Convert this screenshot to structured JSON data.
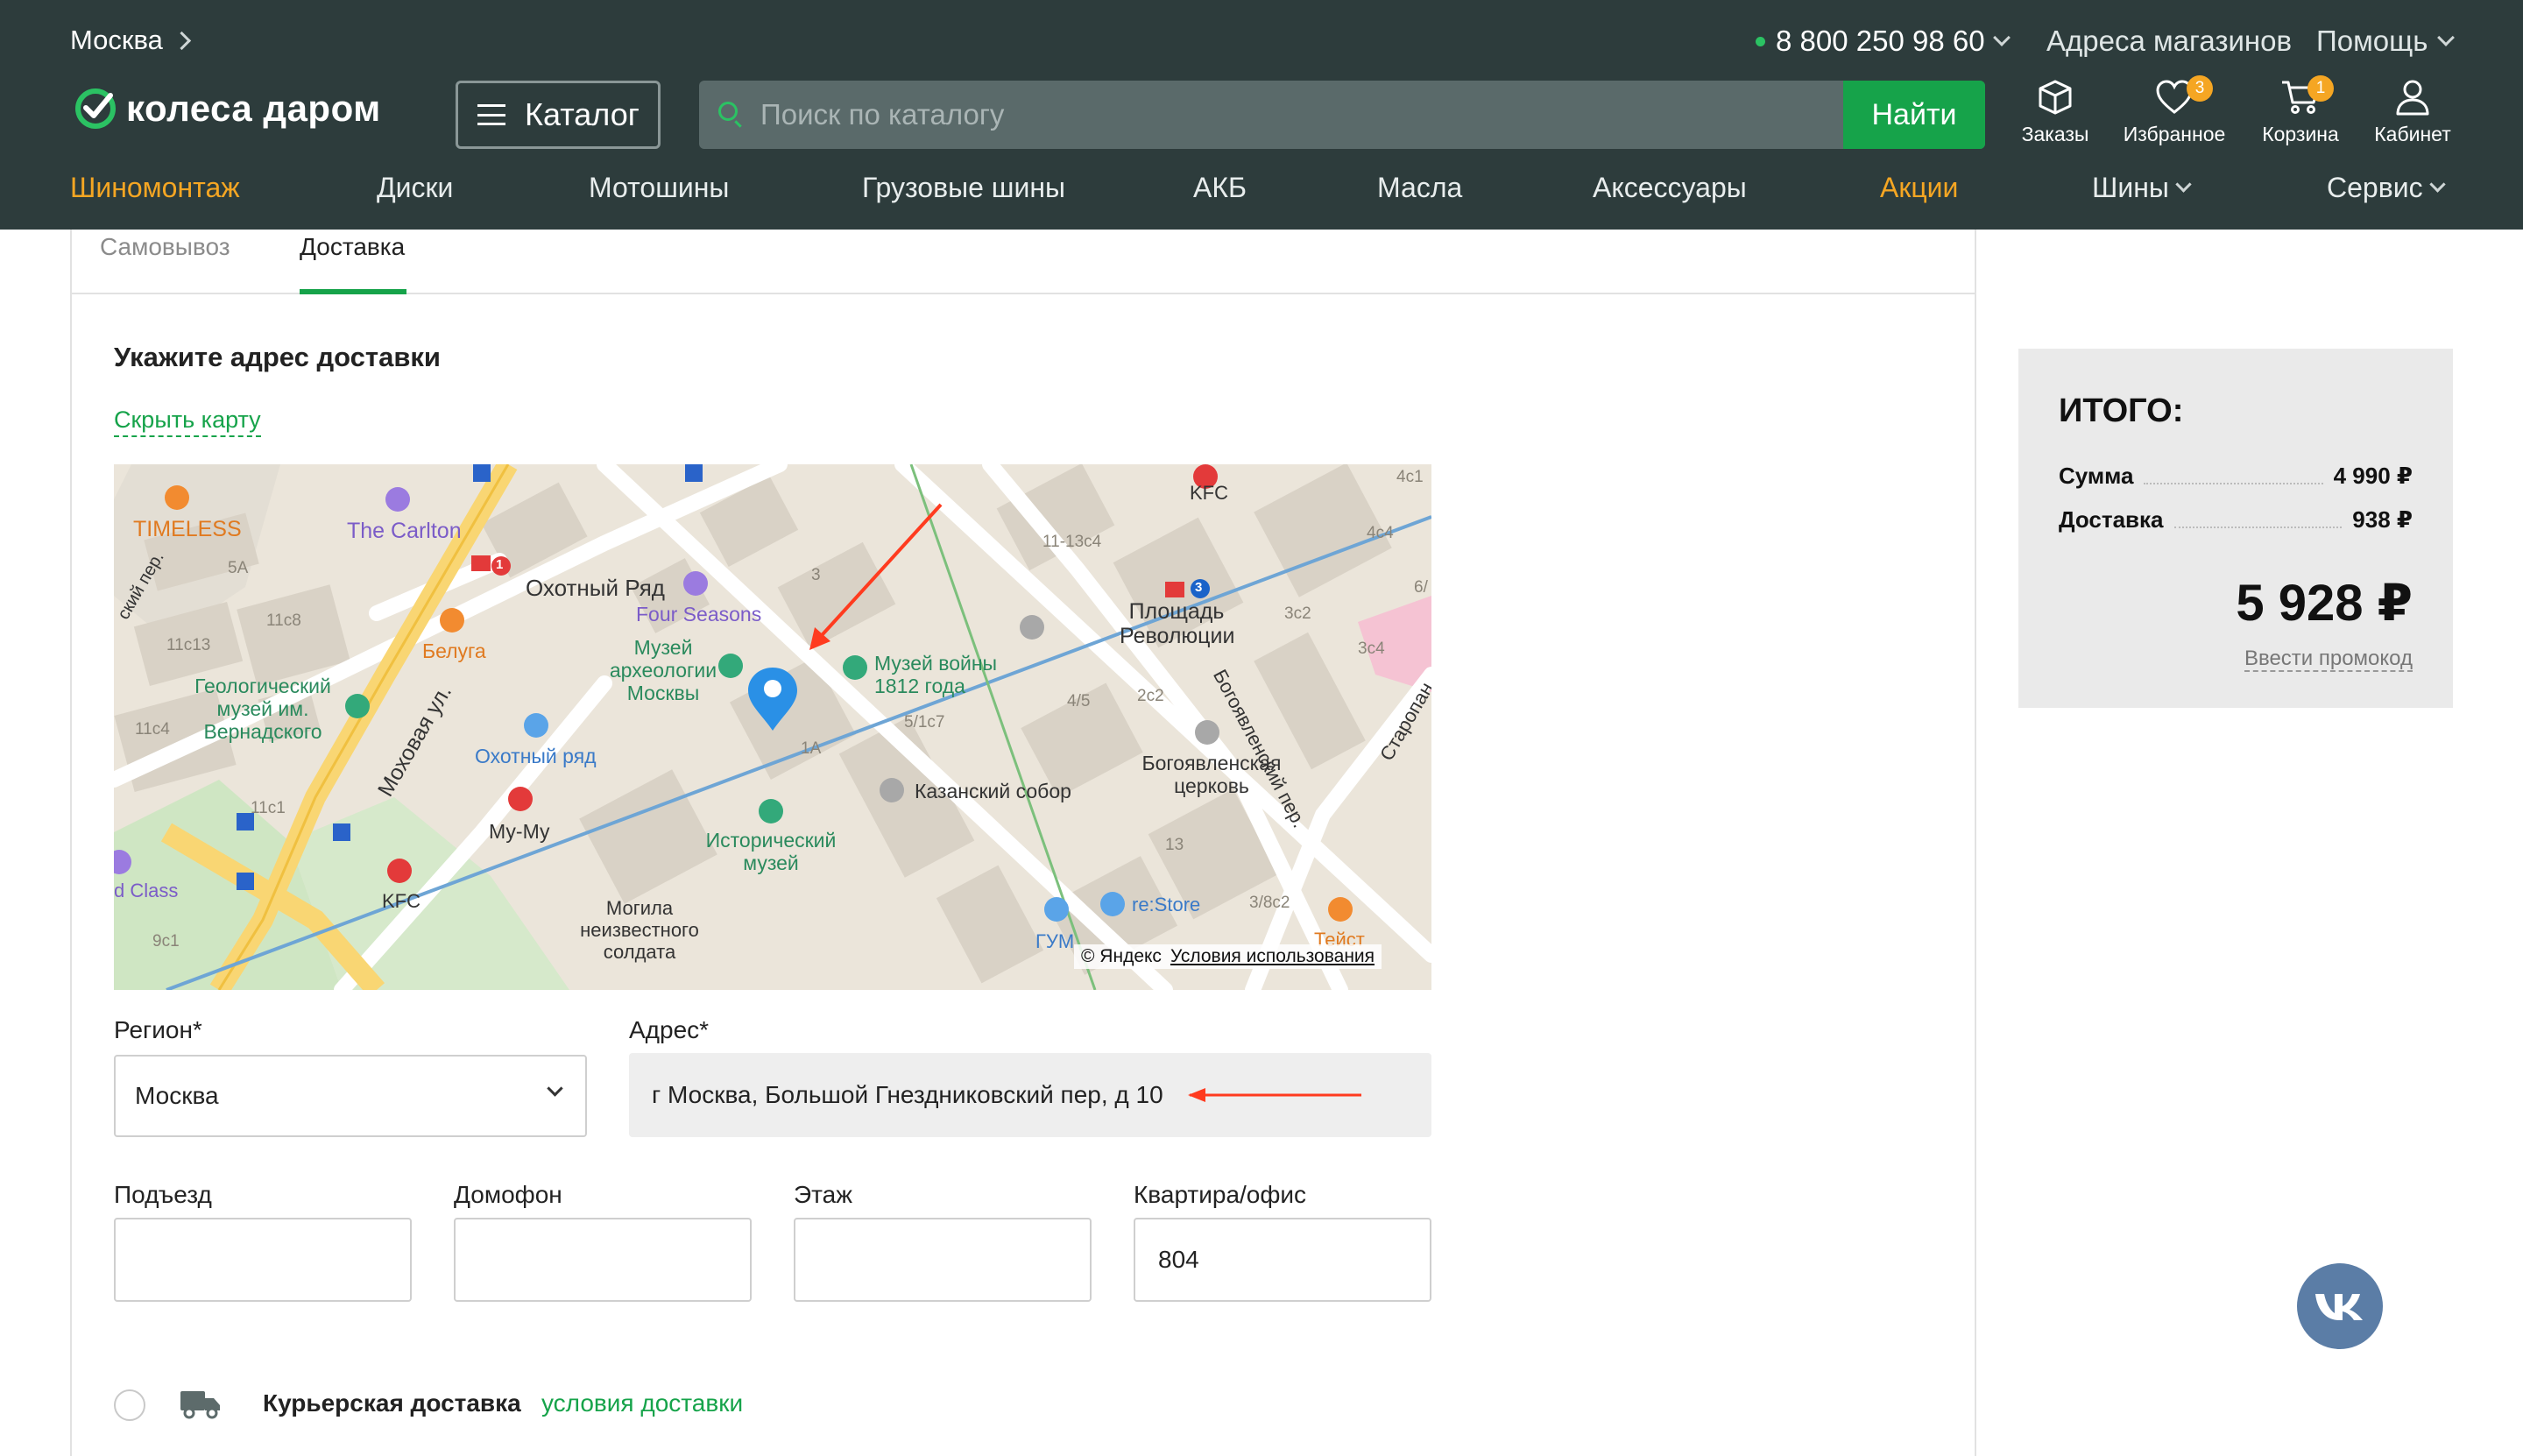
{
  "header": {
    "city": "Москва",
    "phone": "8 800 250 98 60",
    "stores_link": "Адреса магазинов",
    "help": "Помощь",
    "logo_text": "колеса даром",
    "catalog_button": "Каталог",
    "search_placeholder": "Поиск по каталогу",
    "search_button": "Найти",
    "icons": {
      "orders": "Заказы",
      "favorites": "Избранное",
      "favorites_count": "3",
      "cart": "Корзина",
      "cart_count": "1",
      "account": "Кабинет"
    },
    "nav": [
      "Шиномонтаж",
      "Диски",
      "Мотошины",
      "Грузовые шины",
      "АКБ",
      "Масла",
      "Аксессуары",
      "Акции",
      "Шины",
      "Сервис"
    ]
  },
  "tabs": {
    "pickup": "Самовывоз",
    "delivery": "Доставка"
  },
  "delivery": {
    "title": "Укажите адрес доставки",
    "hide_map": "Скрыть карту",
    "map": {
      "labels": {
        "timeless": "TIMELESS",
        "carlton": "The Carlton",
        "okhotny": "Охотный Ряд",
        "four_seasons": "Four Seasons",
        "belugа": "Белуга",
        "museum_arch": "Музей археологии Москвы",
        "museum_war": "Музей войны 1812 года",
        "ploshad": "Площадь Революции",
        "geo_museum": "Геологический музей им. Вернадского",
        "okhotny_mall": "Охотный ряд",
        "mokhovaya": "Моховая ул.",
        "kazan": "Казанский собор",
        "bogoyav_church": "Богоявленская церковь",
        "bogoyav_lane": "Богоявленский пер.",
        "staropan": "Старопан",
        "hist_museum": "Исторический музей",
        "mumu": "Му-Му",
        "kfc1": "KFC",
        "kfc2": "KFC",
        "tomb": "Могила неизвестного солдата",
        "gum": "ГУМ",
        "restore": "re:Store",
        "teist": "Тейст",
        "d_class": "d Class",
        "lane": "ский пер.",
        "h1": "5А",
        "h2": "11с8",
        "h3": "11с13",
        "h4": "11с4",
        "h5": "11с1",
        "h6": "9с1",
        "h7": "11-13с4",
        "h8": "4с1",
        "h9": "4с4",
        "h10": "6/",
        "h11": "3с2",
        "h12": "3с4",
        "h13": "2с2",
        "h14": "4/5",
        "h15": "5/1с7",
        "h16": "1А",
        "h17": "3",
        "h18": "13",
        "h19": "3/8с2",
        "metro1": "1",
        "metro3": "3"
      },
      "copyright": "© Яндекс",
      "terms": "Условия использования"
    },
    "region_label": "Регион*",
    "region_value": "Москва",
    "address_label": "Адрес*",
    "address_value": "г Москва, Большой Гнездниковский пер, д 10",
    "entrance_label": "Подъезд",
    "intercom_label": "Домофон",
    "floor_label": "Этаж",
    "apartment_label": "Квартира/офис",
    "entrance_value": "",
    "intercom_value": "",
    "floor_value": "",
    "apartment_value": "804",
    "courier_label": "Курьерская доставка",
    "courier_conditions": "условия доставки"
  },
  "summary": {
    "title": "ИТОГО:",
    "sum_label": "Сумма",
    "sum_value": "4 990 ₽",
    "delivery_label": "Доставка",
    "delivery_value": "938 ₽",
    "total": "5 928 ₽",
    "promo": "Ввести промокод"
  },
  "colors": {
    "brand_green": "#16a34a",
    "header_bg": "#2d3c3c",
    "accent_orange": "#f5a623",
    "arrow_red": "#ff3b1f"
  }
}
